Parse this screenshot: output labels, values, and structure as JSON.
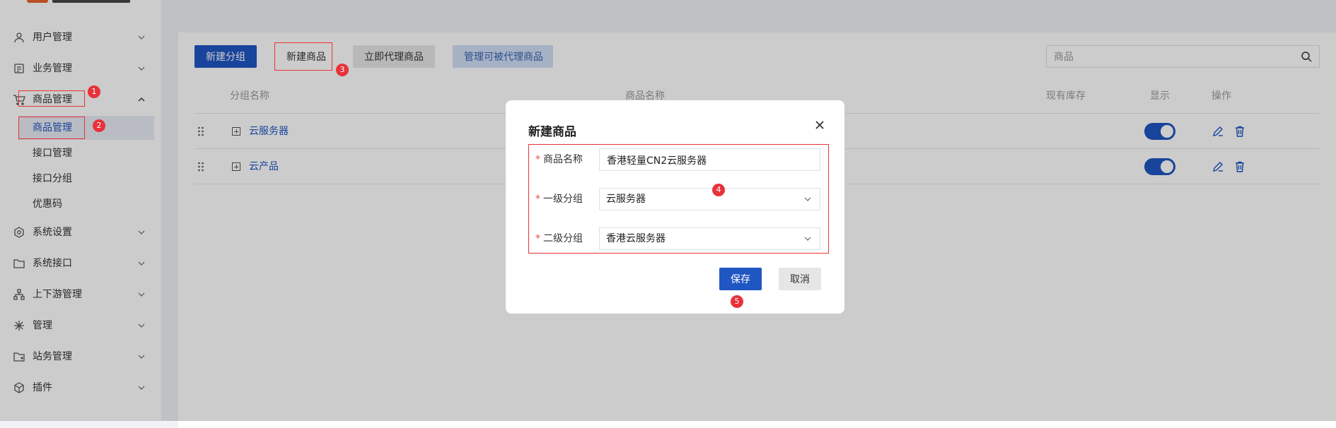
{
  "sidebar": {
    "menu": [
      {
        "label": "用户管理",
        "icon": "user-icon",
        "expanded": false
      },
      {
        "label": "业务管理",
        "icon": "list-icon",
        "expanded": false
      },
      {
        "label": "商品管理",
        "icon": "cart-icon",
        "expanded": true,
        "children": [
          {
            "label": "商品管理",
            "active": true
          },
          {
            "label": "接口管理"
          },
          {
            "label": "接口分组"
          },
          {
            "label": "优惠码"
          }
        ]
      },
      {
        "label": "系统设置",
        "icon": "gear-icon",
        "expanded": false
      },
      {
        "label": "系统接口",
        "icon": "folder-icon",
        "expanded": false
      },
      {
        "label": "上下游管理",
        "icon": "hierarchy-icon",
        "expanded": false
      },
      {
        "label": "管理",
        "icon": "asterisk-icon",
        "expanded": false
      },
      {
        "label": "站务管理",
        "icon": "folder-plus-icon",
        "expanded": false
      },
      {
        "label": "插件",
        "icon": "cube-icon",
        "expanded": false
      }
    ]
  },
  "toolbar": {
    "new_group": "新建分组",
    "new_product": "新建商品",
    "proxy_now": "立即代理商品",
    "manage_proxy": "管理可被代理商品",
    "search_placeholder": "商品"
  },
  "table": {
    "headers": [
      "分组名称",
      "商品名称",
      "现有库存",
      "显示",
      "操作"
    ],
    "rows": [
      {
        "group": "云服务器",
        "show": true
      },
      {
        "group": "云产品",
        "show": true
      }
    ]
  },
  "modal": {
    "title": "新建商品",
    "fields": {
      "name": {
        "label": "商品名称",
        "value": "香港轻量CN2云服务器"
      },
      "group1": {
        "label": "一级分组",
        "value": "云服务器"
      },
      "group2": {
        "label": "二级分组",
        "value": "香港云服务器"
      }
    },
    "save": "保存",
    "cancel": "取消"
  },
  "annotations": [
    "1",
    "2",
    "3",
    "4",
    "5"
  ],
  "colors": {
    "accent": "#1f56c2",
    "annotation": "#e8323a"
  }
}
